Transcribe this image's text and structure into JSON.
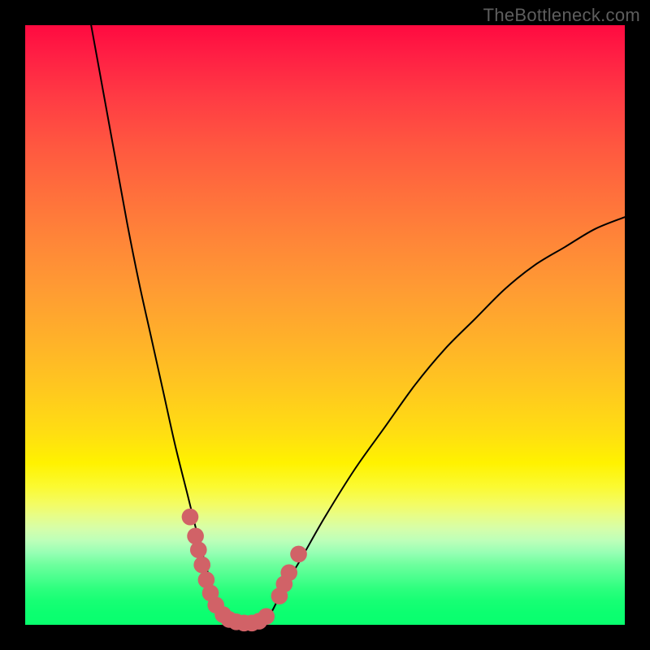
{
  "watermark": "TheBottleneck.com",
  "colors": {
    "background": "#000000",
    "curve": "#000000",
    "marker": "#d16267",
    "text": "#5e5e5e"
  },
  "chart_data": {
    "type": "line",
    "title": "",
    "xlabel": "",
    "ylabel": "",
    "xlim": [
      0,
      100
    ],
    "ylim": [
      0,
      100
    ],
    "grid": false,
    "description": "Bottleneck curve: V-shaped profile with asymmetric arms. Left arm descends steeply from near (11, 100) to a flat minimum across roughly x=31–40 at y≈0, right arm rises less steeply to about (100, 68). Pink rounded markers cluster around and across the minimum.",
    "series": [
      {
        "name": "bottleneck-curve",
        "x": [
          11,
          13,
          15,
          17,
          19,
          21,
          23,
          25,
          27,
          29,
          31,
          33,
          35,
          37,
          39,
          41,
          43,
          46,
          50,
          55,
          60,
          65,
          70,
          75,
          80,
          85,
          90,
          95,
          100
        ],
        "y": [
          100,
          89,
          78,
          67,
          57,
          48,
          39,
          30,
          22,
          14,
          7,
          2,
          0,
          0,
          0,
          2,
          6,
          11,
          18,
          26,
          33,
          40,
          46,
          51,
          56,
          60,
          63,
          66,
          68
        ]
      }
    ],
    "markers": [
      {
        "x": 27.5,
        "y": 18.0,
        "r": 1.4
      },
      {
        "x": 28.4,
        "y": 14.8,
        "r": 1.4
      },
      {
        "x": 28.9,
        "y": 12.5,
        "r": 1.4
      },
      {
        "x": 29.5,
        "y": 10.0,
        "r": 1.4
      },
      {
        "x": 30.2,
        "y": 7.5,
        "r": 1.4
      },
      {
        "x": 30.9,
        "y": 5.3,
        "r": 1.4
      },
      {
        "x": 31.8,
        "y": 3.3,
        "r": 1.4
      },
      {
        "x": 33.0,
        "y": 1.7,
        "r": 1.4
      },
      {
        "x": 34.0,
        "y": 0.9,
        "r": 1.4
      },
      {
        "x": 35.2,
        "y": 0.5,
        "r": 1.4
      },
      {
        "x": 36.5,
        "y": 0.3,
        "r": 1.4
      },
      {
        "x": 37.8,
        "y": 0.3,
        "r": 1.4
      },
      {
        "x": 39.0,
        "y": 0.6,
        "r": 1.4
      },
      {
        "x": 40.2,
        "y": 1.4,
        "r": 1.4
      },
      {
        "x": 42.4,
        "y": 4.8,
        "r": 1.4
      },
      {
        "x": 43.2,
        "y": 6.8,
        "r": 1.4
      },
      {
        "x": 44.0,
        "y": 8.7,
        "r": 1.4
      },
      {
        "x": 45.6,
        "y": 11.8,
        "r": 1.4
      }
    ]
  }
}
